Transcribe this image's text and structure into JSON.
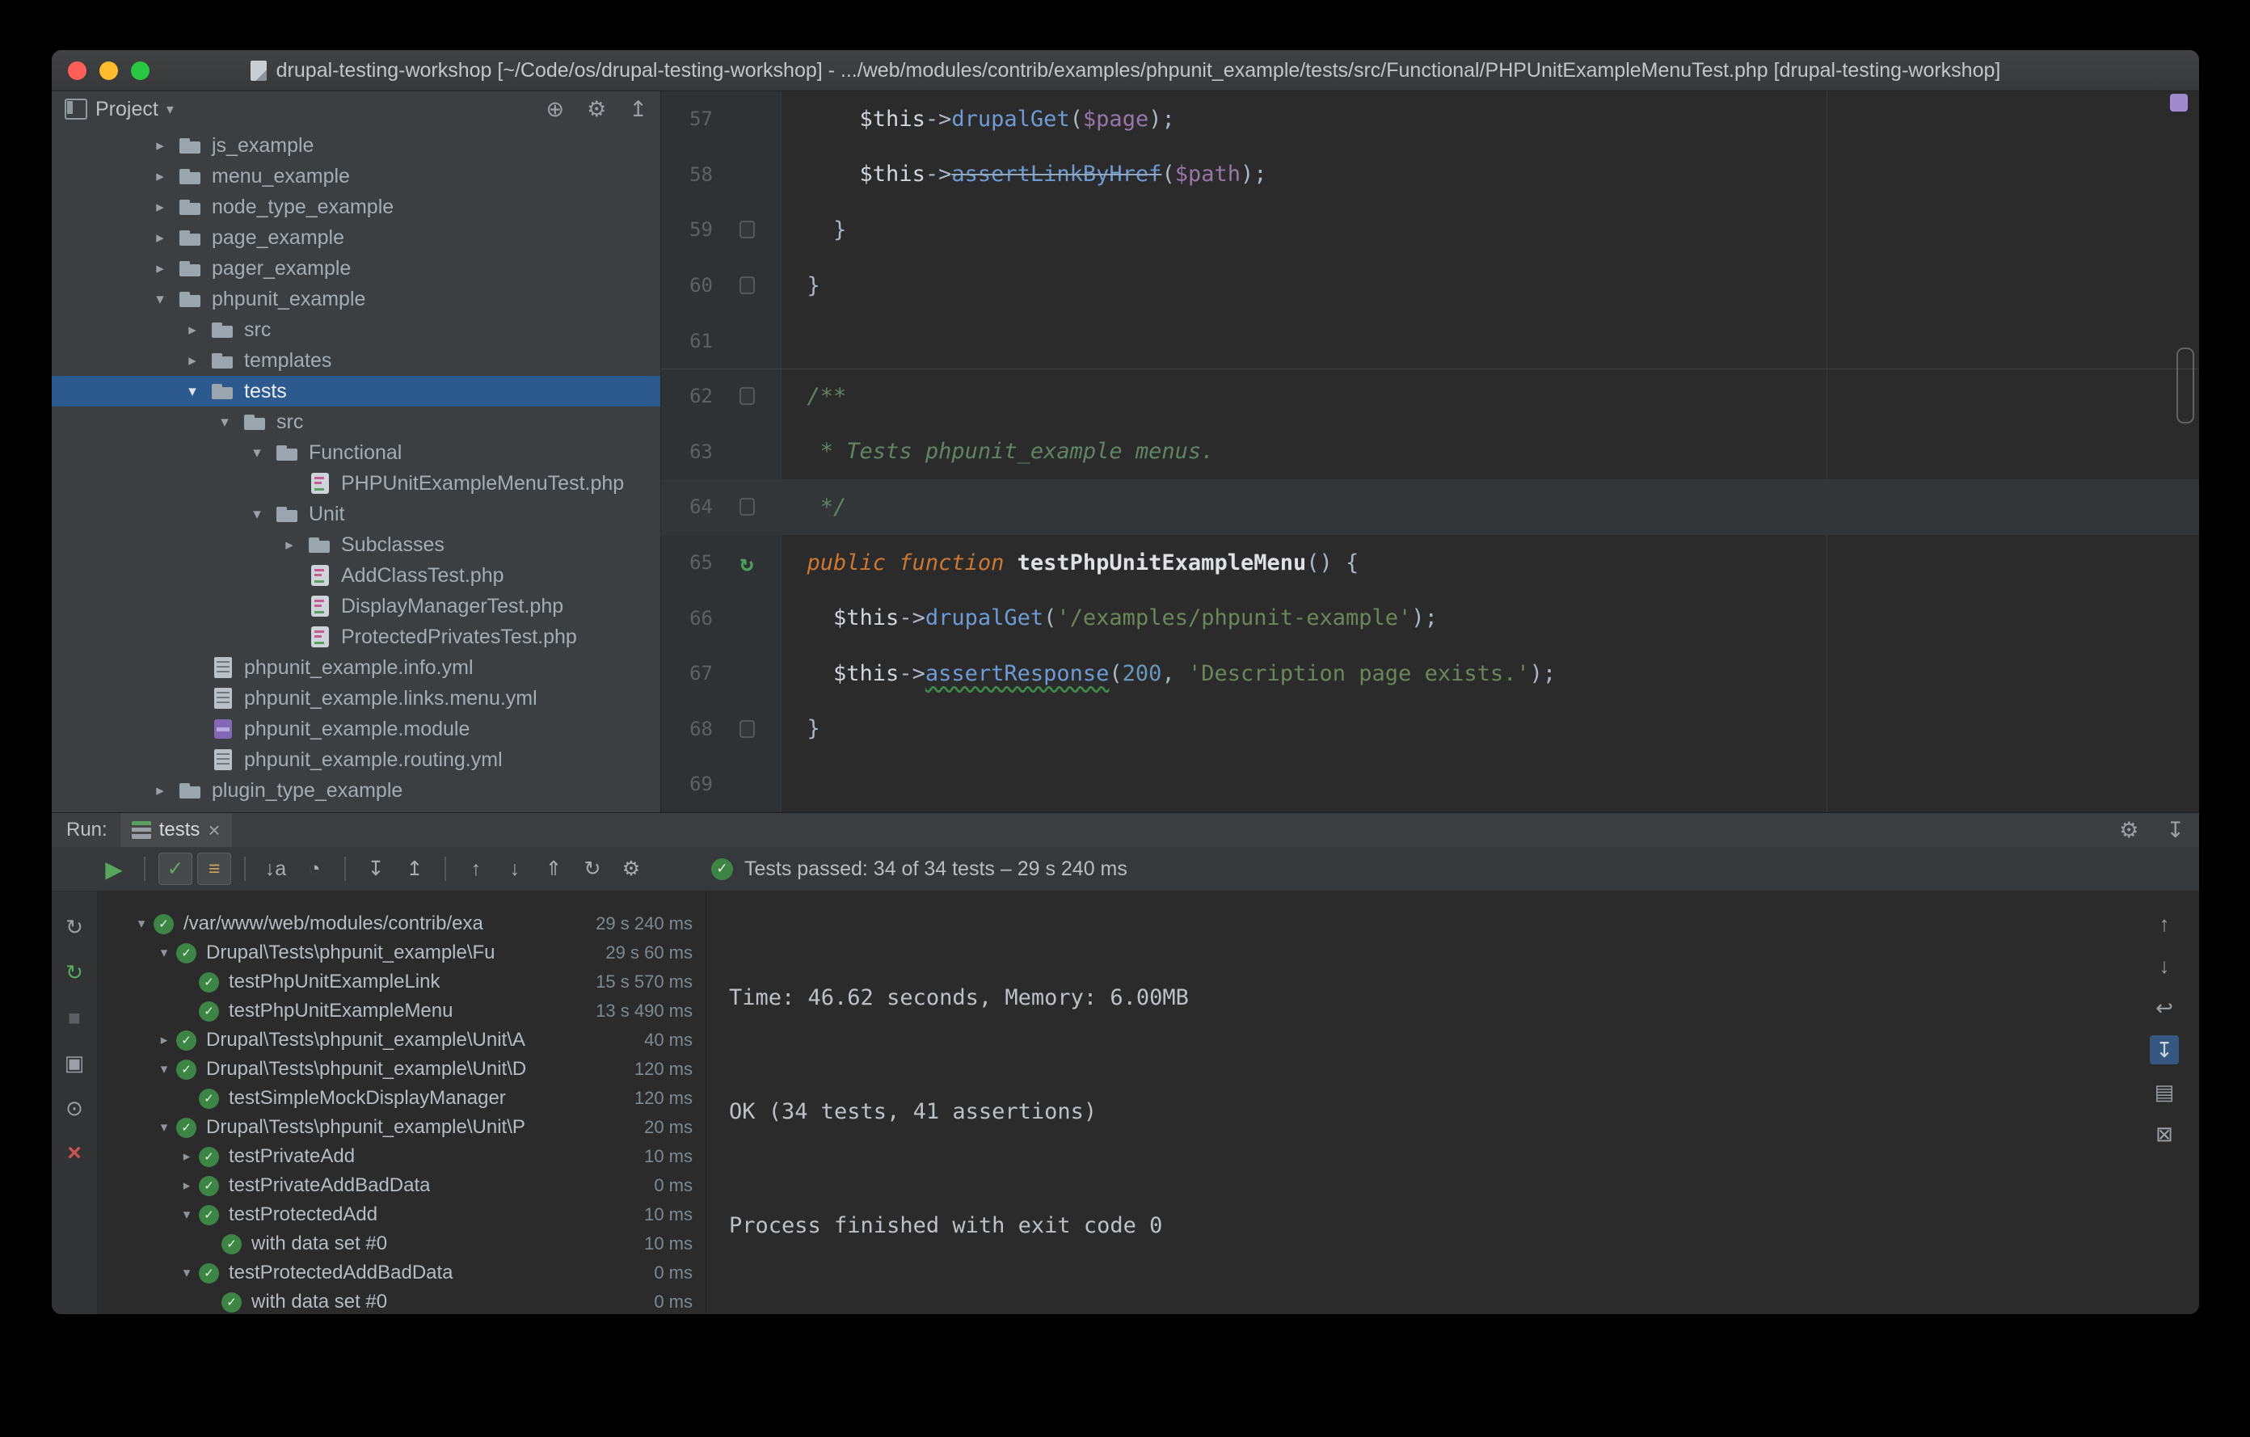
{
  "colors": {
    "selection_blue": "#2d5a8e",
    "pass_green": "#3d8544",
    "keyword_orange": "#cc7832",
    "string_green": "#6a8759",
    "error_red": "#c75450",
    "stripe_purple": "#a28ad0"
  },
  "titlebar": {
    "title": "drupal-testing-workshop [~/Code/os/drupal-testing-workshop] - .../web/modules/contrib/examples/phpunit_example/tests/src/Functional/PHPUnitExampleMenuTest.php [drupal-testing-workshop]"
  },
  "project_panel": {
    "title": "Project",
    "caret": "▾",
    "header_icons": [
      {
        "name": "locate-file-icon",
        "glyph": "⊕",
        "cls": ""
      },
      {
        "name": "settings-gear-icon",
        "glyph": "⚙",
        "cls": ""
      },
      {
        "name": "collapse-all-icon",
        "glyph": "↥",
        "cls": ""
      }
    ],
    "tree": [
      {
        "label": "js_example",
        "depth": 1,
        "arrow": "▸",
        "icon": "folder",
        "cls": ""
      },
      {
        "label": "menu_example",
        "depth": 1,
        "arrow": "▸",
        "icon": "folder",
        "cls": ""
      },
      {
        "label": "node_type_example",
        "depth": 1,
        "arrow": "▸",
        "icon": "folder",
        "cls": ""
      },
      {
        "label": "page_example",
        "depth": 1,
        "arrow": "▸",
        "icon": "folder",
        "cls": ""
      },
      {
        "label": "pager_example",
        "depth": 1,
        "arrow": "▸",
        "icon": "folder",
        "cls": ""
      },
      {
        "label": "phpunit_example",
        "depth": 1,
        "arrow": "▾",
        "icon": "folder",
        "cls": ""
      },
      {
        "label": "src",
        "depth": 2,
        "arrow": "▸",
        "icon": "folder",
        "cls": ""
      },
      {
        "label": "templates",
        "depth": 2,
        "arrow": "▸",
        "icon": "folder",
        "cls": ""
      },
      {
        "label": "tests",
        "depth": 2,
        "arrow": "▾",
        "icon": "folder",
        "cls": "selected"
      },
      {
        "label": "src",
        "depth": 3,
        "arrow": "▾",
        "icon": "folder",
        "cls": ""
      },
      {
        "label": "Functional",
        "depth": 4,
        "arrow": "▾",
        "icon": "folder",
        "cls": ""
      },
      {
        "label": "PHPUnitExampleMenuTest.php",
        "depth": 5,
        "arrow": "",
        "icon": "php-test",
        "cls": ""
      },
      {
        "label": "Unit",
        "depth": 4,
        "arrow": "▾",
        "icon": "folder",
        "cls": ""
      },
      {
        "label": "Subclasses",
        "depth": 5,
        "arrow": "▸",
        "icon": "folder",
        "cls": ""
      },
      {
        "label": "AddClassTest.php",
        "depth": 5,
        "arrow": "",
        "icon": "php-test",
        "cls": ""
      },
      {
        "label": "DisplayManagerTest.php",
        "depth": 5,
        "arrow": "",
        "icon": "php-test",
        "cls": ""
      },
      {
        "label": "ProtectedPrivatesTest.php",
        "depth": 5,
        "arrow": "",
        "icon": "php-test",
        "cls": ""
      },
      {
        "label": "phpunit_example.info.yml",
        "depth": 2,
        "arrow": "",
        "icon": "yml",
        "cls": ""
      },
      {
        "label": "phpunit_example.links.menu.yml",
        "depth": 2,
        "arrow": "",
        "icon": "yml",
        "cls": ""
      },
      {
        "label": "phpunit_example.module",
        "depth": 2,
        "arrow": "",
        "icon": "module",
        "cls": ""
      },
      {
        "label": "phpunit_example.routing.yml",
        "depth": 2,
        "arrow": "",
        "icon": "yml",
        "cls": ""
      },
      {
        "label": "plugin_type_example",
        "depth": 1,
        "arrow": "▸",
        "icon": "folder",
        "cls": ""
      }
    ]
  },
  "editor": {
    "lines": [
      {
        "num": "57",
        "cls": "",
        "gutter": "g-none",
        "segments": [
          {
            "t": "      ",
            "c": "pl"
          },
          {
            "t": "$this",
            "c": "v"
          },
          {
            "t": "->",
            "c": "pl"
          },
          {
            "t": "drupalGet",
            "c": "m"
          },
          {
            "t": "(",
            "c": "pl"
          },
          {
            "t": "$page",
            "c": "pr"
          },
          {
            "t": ");",
            "c": "pl"
          }
        ]
      },
      {
        "num": "58",
        "cls": "",
        "gutter": "g-none",
        "segments": [
          {
            "t": "      ",
            "c": "pl"
          },
          {
            "t": "$this",
            "c": "v"
          },
          {
            "t": "->",
            "c": "pl"
          },
          {
            "t": "assertLinkByHref",
            "c": "md"
          },
          {
            "t": "(",
            "c": "pl"
          },
          {
            "t": "$path",
            "c": "pr"
          },
          {
            "t": ");",
            "c": "pl"
          }
        ]
      },
      {
        "num": "59",
        "cls": "",
        "gutter": "g-fold",
        "segments": [
          {
            "t": "    }",
            "c": "pl"
          }
        ]
      },
      {
        "num": "60",
        "cls": "",
        "gutter": "g-fold",
        "segments": [
          {
            "t": "  }",
            "c": "pl"
          }
        ]
      },
      {
        "num": "61",
        "cls": "",
        "gutter": "g-none",
        "segments": []
      },
      {
        "num": "62",
        "cls": "sep",
        "gutter": "g-fold",
        "segments": [
          {
            "t": "  ",
            "c": "pl"
          },
          {
            "t": "/**",
            "c": "c"
          }
        ]
      },
      {
        "num": "63",
        "cls": "",
        "gutter": "g-none",
        "segments": [
          {
            "t": "   ",
            "c": "pl"
          },
          {
            "t": "* Tests phpunit_example menus.",
            "c": "c"
          }
        ]
      },
      {
        "num": "64",
        "cls": "caret",
        "gutter": "g-fold",
        "segments": [
          {
            "t": "   ",
            "c": "pl"
          },
          {
            "t": "*/",
            "c": "c"
          }
        ]
      },
      {
        "num": "65",
        "cls": "",
        "gutter": "g-run",
        "segments": [
          {
            "t": "  ",
            "c": "pl"
          },
          {
            "t": "public function ",
            "c": "k"
          },
          {
            "t": "testPhpUnitExampleMenu",
            "c": "f"
          },
          {
            "t": "() {",
            "c": "pl"
          }
        ]
      },
      {
        "num": "66",
        "cls": "",
        "gutter": "g-none",
        "segments": [
          {
            "t": "    ",
            "c": "pl"
          },
          {
            "t": "$this",
            "c": "v"
          },
          {
            "t": "->",
            "c": "pl"
          },
          {
            "t": "drupalGet",
            "c": "m"
          },
          {
            "t": "(",
            "c": "pl"
          },
          {
            "t": "'/examples/phpunit-example'",
            "c": "s"
          },
          {
            "t": ");",
            "c": "pl"
          }
        ]
      },
      {
        "num": "67",
        "cls": "",
        "gutter": "g-none",
        "segments": [
          {
            "t": "    ",
            "c": "pl"
          },
          {
            "t": "$this",
            "c": "v"
          },
          {
            "t": "->",
            "c": "pl"
          },
          {
            "t": "assertResponse",
            "c": "mw"
          },
          {
            "t": "(",
            "c": "pl"
          },
          {
            "t": "200",
            "c": "n"
          },
          {
            "t": ", ",
            "c": "pl"
          },
          {
            "t": "'Description page exists.'",
            "c": "s"
          },
          {
            "t": ");",
            "c": "pl"
          }
        ]
      },
      {
        "num": "68",
        "cls": "",
        "gutter": "g-fold",
        "segments": [
          {
            "t": "  }",
            "c": "pl"
          }
        ]
      },
      {
        "num": "69",
        "cls": "",
        "gutter": "g-none",
        "segments": []
      }
    ]
  },
  "run_panel": {
    "label": "Run:",
    "tab": {
      "title": "tests",
      "close_glyph": "×"
    },
    "header_icons": [
      {
        "name": "settings-gear-icon",
        "glyph": "⚙",
        "cls": ""
      },
      {
        "name": "hide-panel-icon",
        "glyph": "↧",
        "cls": ""
      }
    ],
    "toolbar": [
      {
        "name": "rerun-tests-icon",
        "glyph": "▶",
        "cls": "play"
      },
      {
        "name": "separator",
        "glyph": "",
        "cls": "sep"
      },
      {
        "name": "show-passed-toggle",
        "glyph": "✓",
        "cls": "toggle-on pass"
      },
      {
        "name": "show-ignored-toggle",
        "glyph": "≡",
        "cls": "toggle-on ignored"
      },
      {
        "name": "separator",
        "glyph": "",
        "cls": "sep"
      },
      {
        "name": "sort-alphabetically-icon",
        "glyph": "↓a",
        "cls": ""
      },
      {
        "name": "sort-by-duration-icon",
        "glyph": "◔",
        "cls": ""
      },
      {
        "name": "separator",
        "glyph": "",
        "cls": "sep"
      },
      {
        "name": "expand-all-icon",
        "glyph": "↧",
        "cls": ""
      },
      {
        "name": "collapse-all-icon",
        "glyph": "↥",
        "cls": ""
      },
      {
        "name": "separator",
        "glyph": "",
        "cls": "sep"
      },
      {
        "name": "previous-failed-test-icon",
        "glyph": "↑",
        "cls": ""
      },
      {
        "name": "next-failed-test-icon",
        "glyph": "↓",
        "cls": ""
      },
      {
        "name": "import-test-results-icon",
        "glyph": "⇑",
        "cls": ""
      },
      {
        "name": "test-history-icon",
        "glyph": "↻",
        "cls": ""
      },
      {
        "name": "run-options-gear-icon",
        "glyph": "⚙",
        "cls": ""
      }
    ],
    "status": {
      "text": "Tests passed: 34 of 34 tests – 29 s 240 ms"
    },
    "left_strip": [
      {
        "name": "rerun-icon",
        "glyph": "↻",
        "cls": ""
      },
      {
        "name": "rerun-failed-tests-icon",
        "glyph": "↻",
        "cls": "green"
      },
      {
        "name": "stop-icon",
        "glyph": "■",
        "cls": "disabled"
      },
      {
        "name": "restore-layout-icon",
        "glyph": "▣",
        "cls": ""
      },
      {
        "name": "pin-tab-icon",
        "glyph": "⊙",
        "cls": ""
      },
      {
        "name": "close-tab-icon",
        "glyph": "×",
        "cls": "red"
      }
    ],
    "right_strip": [
      {
        "name": "scroll-up-icon",
        "glyph": "↑",
        "cls": ""
      },
      {
        "name": "scroll-down-icon",
        "glyph": "↓",
        "cls": ""
      },
      {
        "name": "soft-wrap-icon",
        "glyph": "↩",
        "cls": ""
      },
      {
        "name": "scroll-to-end-icon",
        "glyph": "↧",
        "cls": "active"
      },
      {
        "name": "print-console-icon",
        "glyph": "▤",
        "cls": ""
      },
      {
        "name": "clear-output-icon",
        "glyph": "⊠",
        "cls": ""
      }
    ],
    "tests": [
      {
        "label": "/var/www/web/modules/contrib/exa",
        "time": "29 s 240 ms",
        "depth": 0,
        "arrow": "▾"
      },
      {
        "label": "Drupal\\Tests\\phpunit_example\\Fu",
        "time": "29 s 60 ms",
        "depth": 1,
        "arrow": "▾"
      },
      {
        "label": "testPhpUnitExampleLink",
        "time": "15 s 570 ms",
        "depth": 2,
        "arrow": ""
      },
      {
        "label": "testPhpUnitExampleMenu",
        "time": "13 s 490 ms",
        "depth": 2,
        "arrow": ""
      },
      {
        "label": "Drupal\\Tests\\phpunit_example\\Unit\\A",
        "time": "40 ms",
        "depth": 1,
        "arrow": "▸"
      },
      {
        "label": "Drupal\\Tests\\phpunit_example\\Unit\\D",
        "time": "120 ms",
        "depth": 1,
        "arrow": "▾"
      },
      {
        "label": "testSimpleMockDisplayManager",
        "time": "120 ms",
        "depth": 2,
        "arrow": ""
      },
      {
        "label": "Drupal\\Tests\\phpunit_example\\Unit\\P",
        "time": "20 ms",
        "depth": 1,
        "arrow": "▾"
      },
      {
        "label": "testPrivateAdd",
        "time": "10 ms",
        "depth": 2,
        "arrow": "▸"
      },
      {
        "label": "testPrivateAddBadData",
        "time": "0 ms",
        "depth": 2,
        "arrow": "▸"
      },
      {
        "label": "testProtectedAdd",
        "time": "10 ms",
        "depth": 2,
        "arrow": "▾"
      },
      {
        "label": "with data set #0",
        "time": "10 ms",
        "depth": 3,
        "arrow": ""
      },
      {
        "label": "testProtectedAddBadData",
        "time": "0 ms",
        "depth": 2,
        "arrow": "▾"
      },
      {
        "label": "with data set #0",
        "time": "0 ms",
        "depth": 3,
        "arrow": ""
      }
    ],
    "console": [
      "",
      "",
      "Time: 46.62 seconds, Memory: 6.00MB",
      "",
      "",
      "OK (34 tests, 41 assertions)",
      "",
      "",
      "Process finished with exit code 0"
    ]
  }
}
